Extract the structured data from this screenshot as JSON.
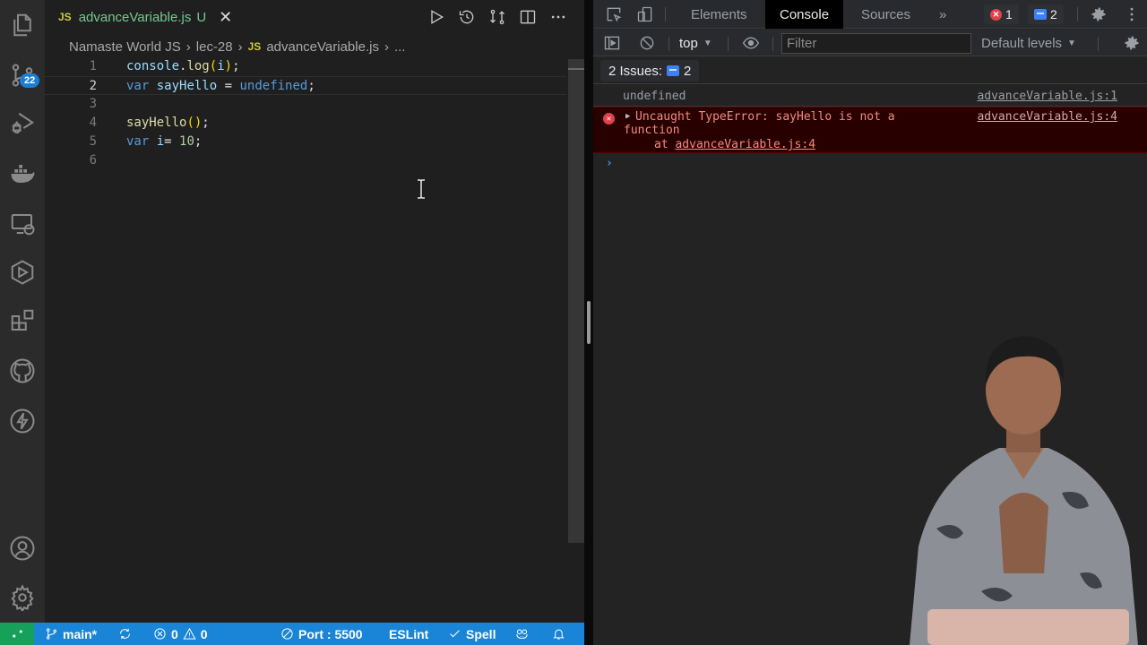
{
  "vscode": {
    "activity_bar": {
      "items": [
        {
          "name": "explorer",
          "icon": "files-icon"
        },
        {
          "name": "source-control",
          "icon": "source-control-icon",
          "badge": "22"
        },
        {
          "name": "run-debug",
          "icon": "run-debug-icon"
        },
        {
          "name": "docker",
          "icon": "docker-icon"
        },
        {
          "name": "remote-explorer",
          "icon": "remote-explorer-icon"
        },
        {
          "name": "extension-play",
          "icon": "hexagon-play-icon"
        },
        {
          "name": "extensions",
          "icon": "extensions-icon"
        },
        {
          "name": "github",
          "icon": "github-icon"
        },
        {
          "name": "thunder-client",
          "icon": "lightning-icon"
        }
      ],
      "bottom_items": [
        {
          "name": "accounts",
          "icon": "account-icon"
        },
        {
          "name": "manage",
          "icon": "gear-icon"
        }
      ]
    },
    "tab": {
      "lang_badge": "JS",
      "filename": "advanceVariable.js",
      "status": "U"
    },
    "breadcrumb": {
      "items": [
        "Namaste World JS",
        "lec-28",
        "advanceVariable.js",
        "..."
      ],
      "file_badge": "JS"
    },
    "code_lines": [
      {
        "num": "1",
        "text": "console.log(i);"
      },
      {
        "num": "2",
        "text": "var sayHello = undefined;"
      },
      {
        "num": "3",
        "text": ""
      },
      {
        "num": "4",
        "text": "sayHello();"
      },
      {
        "num": "5",
        "text": "var i= 10;"
      },
      {
        "num": "6",
        "text": ""
      }
    ],
    "active_line": 2,
    "status_bar": {
      "branch": "main*",
      "errors": "0",
      "warnings": "0",
      "port": "Port : 5500",
      "eslint": "ESLint",
      "spell": "Spell"
    }
  },
  "devtools": {
    "tabs": [
      "Elements",
      "Console",
      "Sources"
    ],
    "active_tab": "Console",
    "more_tabs": "»",
    "error_count": "1",
    "message_count": "2",
    "context": "top",
    "filter_placeholder": "Filter",
    "levels": "Default levels",
    "issues_label": "2 Issues:",
    "issues_count": "2",
    "console": {
      "log": {
        "text": "undefined",
        "source": "advanceVariable.js:1"
      },
      "error": {
        "line1": "Uncaught TypeError: sayHello is not a",
        "line2": "function",
        "at_prefix": "at ",
        "at_link": "advanceVariable.js:4",
        "source": "advanceVariable.js:4"
      },
      "prompt": "›"
    }
  },
  "colors": {
    "status_bar": "#1a85d6",
    "remote_button": "#16a05a",
    "modified_file": "#73c991",
    "error_bg": "#290000",
    "error_text": "#f28b82"
  }
}
